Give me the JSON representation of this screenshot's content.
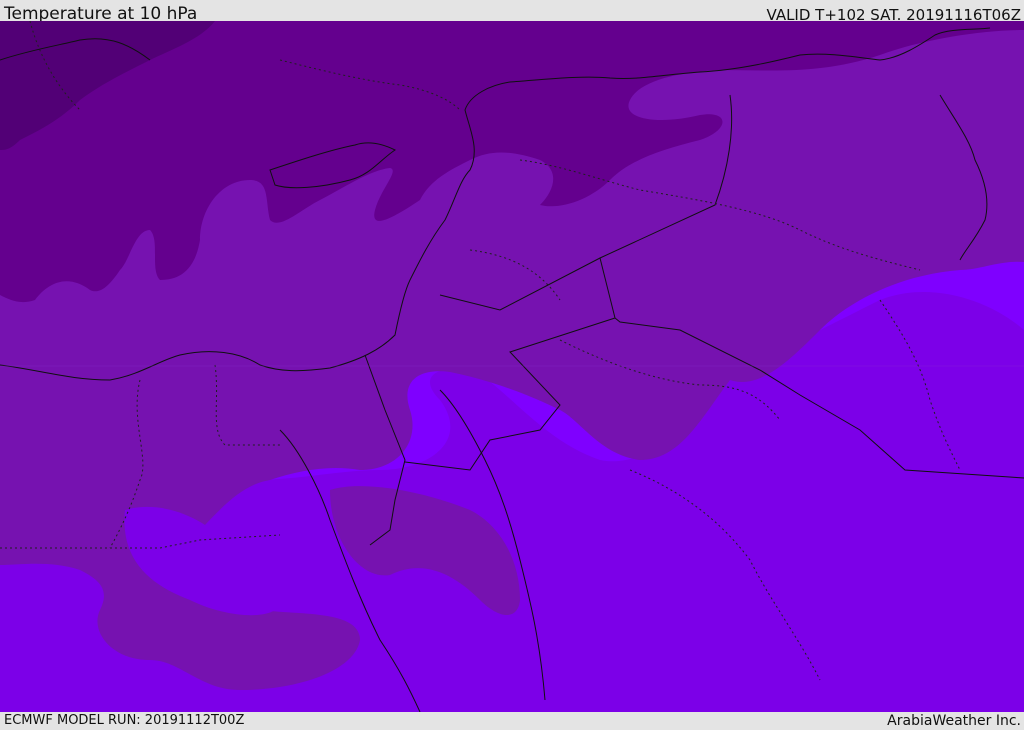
{
  "header": {
    "title": "Temperature at 10 hPa",
    "valid_time": "VALID T+102 SAT. 20191116T06Z"
  },
  "footer": {
    "model_run": "ECMWF MODEL RUN: 20191112T00Z",
    "credit": "ArabiaWeather Inc."
  },
  "map": {
    "field": "temperature",
    "level": "10 hPa",
    "shading_colors": [
      "#520076",
      "#64008e",
      "#7612b0",
      "#7c00e8",
      "#7f00ff"
    ]
  }
}
